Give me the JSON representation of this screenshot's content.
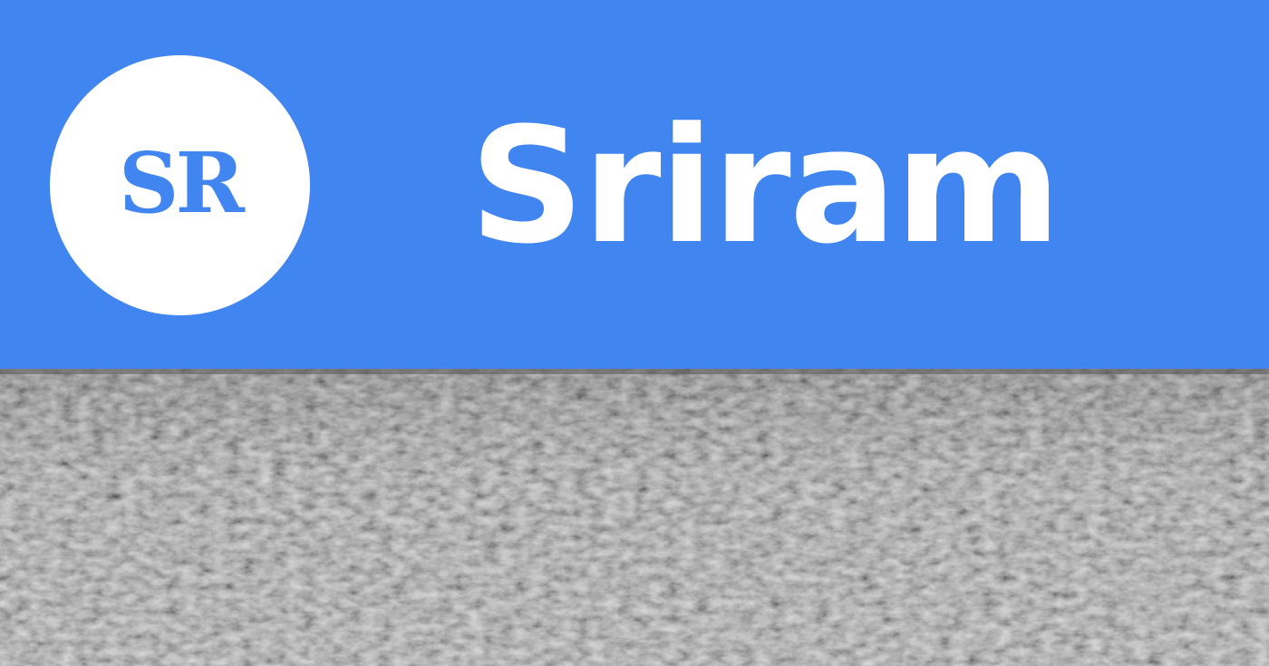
{
  "header": {
    "avatar_initials": "SR",
    "title": "Sriram"
  },
  "icons": {
    "avatar": "profile-monogram-icon"
  },
  "colors": {
    "header_background": "#4185f0",
    "avatar_background": "#ffffff",
    "avatar_text": "#4185f0",
    "title_text": "#ffffff",
    "photo_tone": "#8c8c8c"
  }
}
